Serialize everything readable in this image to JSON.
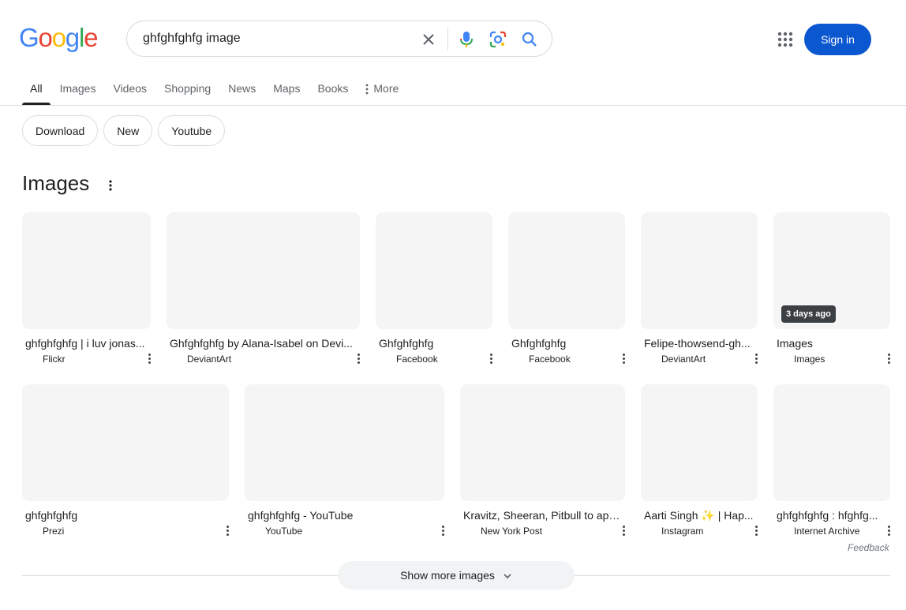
{
  "logo": {
    "text": "Google"
  },
  "search": {
    "query": "ghfghfghfg image"
  },
  "header": {
    "signin_label": "Sign in"
  },
  "tabs": [
    {
      "label": "All"
    },
    {
      "label": "Images"
    },
    {
      "label": "Videos"
    },
    {
      "label": "Shopping"
    },
    {
      "label": "News"
    },
    {
      "label": "Maps"
    },
    {
      "label": "Books"
    },
    {
      "label": "More"
    }
  ],
  "chips": [
    {
      "label": "Download"
    },
    {
      "label": "New"
    },
    {
      "label": "Youtube"
    }
  ],
  "images_section": {
    "title": "Images",
    "row1": [
      {
        "title": "ghfghfghfg | i luv jonas...",
        "source": "Flickr"
      },
      {
        "title": "Ghfghfghfg by Alana-Isabel on Devi...",
        "source": "DeviantArt"
      },
      {
        "title": "Ghfghfghfg",
        "source": "Facebook"
      },
      {
        "title": "Ghfghfghfg",
        "source": "Facebook"
      },
      {
        "title": "Felipe-thowsend-gh...",
        "source": "DeviantArt"
      },
      {
        "title": "Images",
        "source": "Images",
        "badge": "3 days ago"
      }
    ],
    "row2": [
      {
        "title": "ghfghfghfg",
        "source": "Prezi"
      },
      {
        "title": "ghfghfghfg - YouTube",
        "source": "YouTube"
      },
      {
        "title": "Kravitz, Sheeran, Pitbull to app...",
        "source": "New York Post"
      },
      {
        "title": "Aarti Singh ✨ | Hap...",
        "source": "Instagram"
      },
      {
        "title": "ghfghfghfg : hfghfg...",
        "source": "Internet Archive"
      }
    ],
    "feedback": "Feedback",
    "show_more": "Show more images"
  },
  "colors": {
    "accent": "#0b57d0",
    "thumb_bg": "#f5f5f5"
  }
}
